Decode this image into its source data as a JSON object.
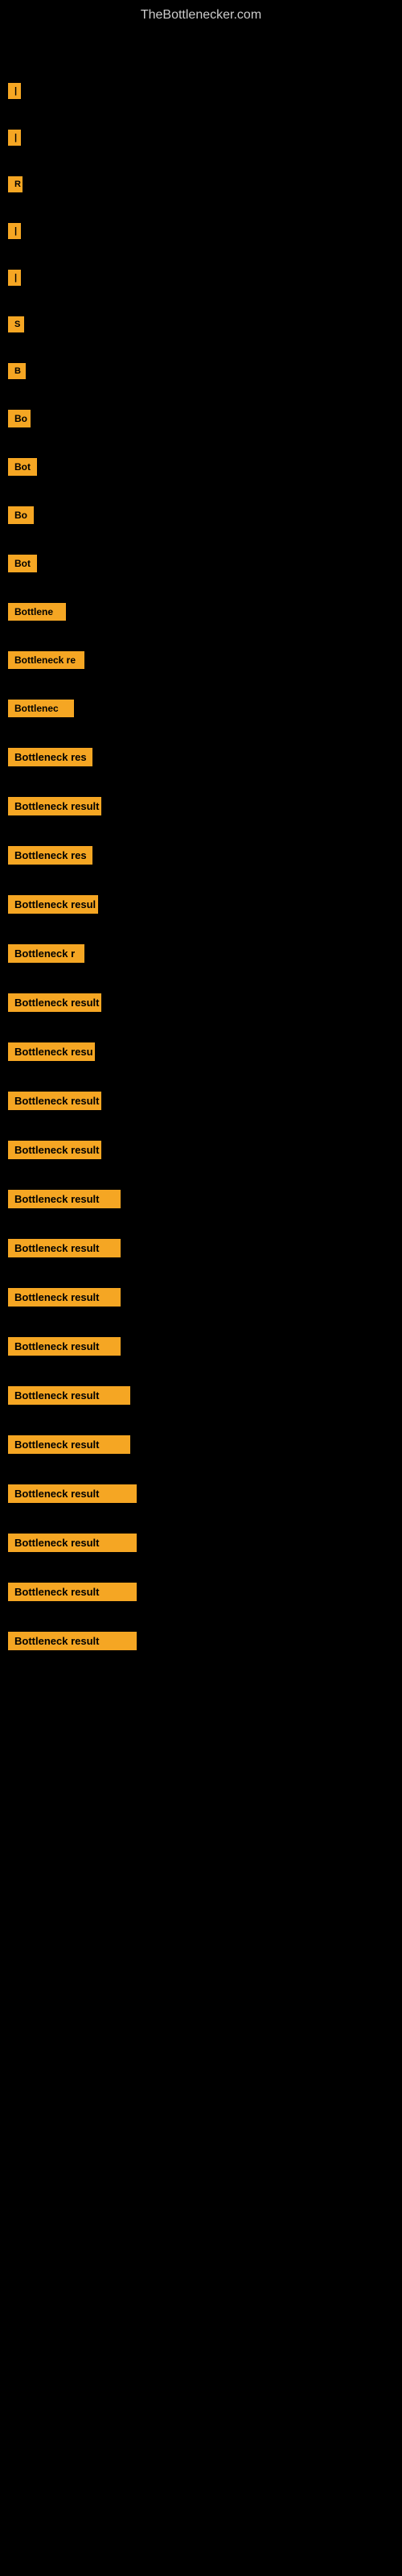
{
  "site": {
    "title": "TheBottlenecker.com"
  },
  "items": [
    {
      "id": 1,
      "label": "|"
    },
    {
      "id": 2,
      "label": "|"
    },
    {
      "id": 3,
      "label": "R"
    },
    {
      "id": 4,
      "label": "|"
    },
    {
      "id": 5,
      "label": "|"
    },
    {
      "id": 6,
      "label": "S"
    },
    {
      "id": 7,
      "label": "B"
    },
    {
      "id": 8,
      "label": "Bo"
    },
    {
      "id": 9,
      "label": "Bot"
    },
    {
      "id": 10,
      "label": "Bo"
    },
    {
      "id": 11,
      "label": "Bot"
    },
    {
      "id": 12,
      "label": "Bottlene"
    },
    {
      "id": 13,
      "label": "Bottleneck re"
    },
    {
      "id": 14,
      "label": "Bottlenec"
    },
    {
      "id": 15,
      "label": "Bottleneck res"
    },
    {
      "id": 16,
      "label": "Bottleneck result"
    },
    {
      "id": 17,
      "label": "Bottleneck res"
    },
    {
      "id": 18,
      "label": "Bottleneck resul"
    },
    {
      "id": 19,
      "label": "Bottleneck r"
    },
    {
      "id": 20,
      "label": "Bottleneck result"
    },
    {
      "id": 21,
      "label": "Bottleneck resu"
    },
    {
      "id": 22,
      "label": "Bottleneck result"
    },
    {
      "id": 23,
      "label": "Bottleneck result"
    },
    {
      "id": 24,
      "label": "Bottleneck result"
    },
    {
      "id": 25,
      "label": "Bottleneck result"
    },
    {
      "id": 26,
      "label": "Bottleneck result"
    },
    {
      "id": 27,
      "label": "Bottleneck result"
    },
    {
      "id": 28,
      "label": "Bottleneck result"
    },
    {
      "id": 29,
      "label": "Bottleneck result"
    },
    {
      "id": 30,
      "label": "Bottleneck result"
    },
    {
      "id": 31,
      "label": "Bottleneck result"
    },
    {
      "id": 32,
      "label": "Bottleneck result"
    },
    {
      "id": 33,
      "label": "Bottleneck result"
    }
  ]
}
